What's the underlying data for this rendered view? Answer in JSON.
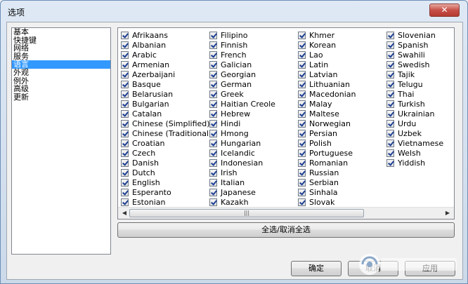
{
  "window": {
    "title": "选项",
    "close_glyph": "✕"
  },
  "nav": {
    "items": [
      "基本",
      "快捷键",
      "网络",
      "服务",
      "语言",
      "外观",
      "例外",
      "高级",
      "更新"
    ],
    "selected_index": 4
  },
  "languages": {
    "columns": [
      [
        "Afrikaans",
        "Albanian",
        "Arabic",
        "Armenian",
        "Azerbaijani",
        "Basque",
        "Belarusian",
        "Bulgarian",
        "Catalan",
        "Chinese (Simplified)",
        "Chinese (Traditional)",
        "Croatian",
        "Czech",
        "Danish",
        "Dutch",
        "English",
        "Esperanto",
        "Estonian"
      ],
      [
        "Filipino",
        "Finnish",
        "French",
        "Galician",
        "Georgian",
        "German",
        "Greek",
        "Haitian Creole",
        "Hebrew",
        "Hindi",
        "Hmong",
        "Hungarian",
        "Icelandic",
        "Indonesian",
        "Irish",
        "Italian",
        "Japanese",
        "Kazakh"
      ],
      [
        "Khmer",
        "Korean",
        "Lao",
        "Latin",
        "Latvian",
        "Lithuanian",
        "Macedonian",
        "Malay",
        "Maltese",
        "Norwegian",
        "Persian",
        "Polish",
        "Portuguese",
        "Romanian",
        "Russian",
        "Serbian",
        "Sinhala",
        "Slovak"
      ],
      [
        "Slovenian",
        "Spanish",
        "Swahili",
        "Swedish",
        "Tajik",
        "Telugu",
        "Thai",
        "Turkish",
        "Ukrainian",
        "Urdu",
        "Uzbek",
        "Vietnamese",
        "Welsh",
        "Yiddish"
      ]
    ],
    "all_checked": true
  },
  "scrollbar": {
    "left_arrow": "◀",
    "right_arrow": "▶",
    "grip": "|||"
  },
  "buttons": {
    "toggle_all": "全选/取消全选",
    "ok": "确定",
    "cancel": "取消",
    "apply": "应用"
  },
  "colors": {
    "selection": "#3399ff",
    "check": "#1c3f94",
    "close": "#c75048"
  }
}
